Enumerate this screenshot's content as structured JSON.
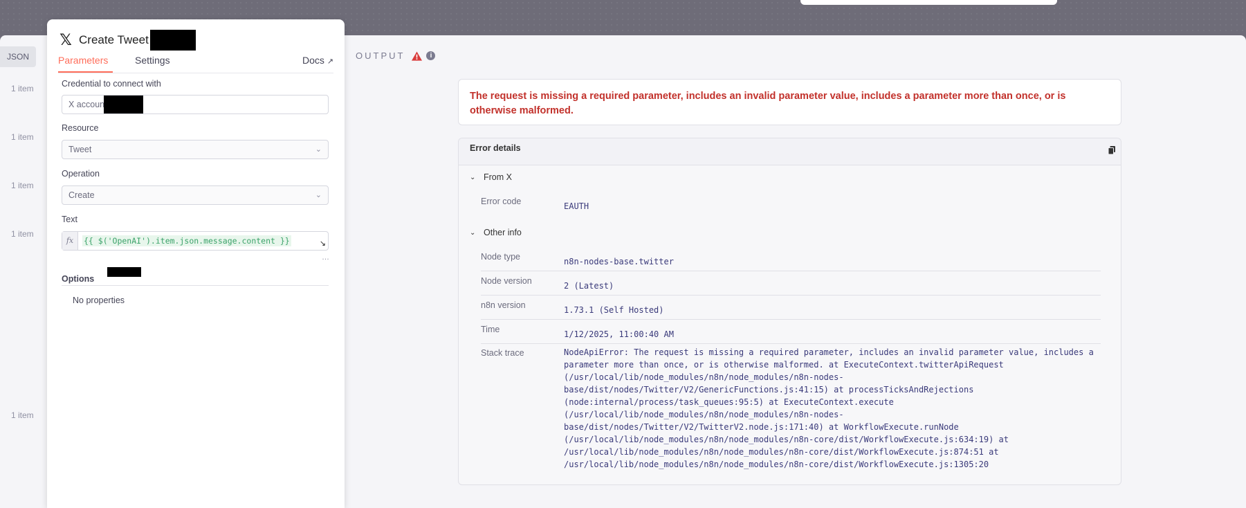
{
  "input_panel": {
    "json_tab": "JSON",
    "items": [
      "1 item",
      "1 item",
      "1 item",
      "1 item",
      "1 item"
    ]
  },
  "node": {
    "title": "Create Tweet",
    "tabs": [
      {
        "label": "Parameters",
        "active": true
      },
      {
        "label": "Settings",
        "active": false
      }
    ],
    "docs_label": "Docs",
    "credential": {
      "label": "Credential to connect with",
      "value": "X accoun"
    },
    "resource": {
      "label": "Resource",
      "value": "Tweet"
    },
    "operation": {
      "label": "Operation",
      "value": "Create"
    },
    "text": {
      "label": "Text",
      "fx": "fx",
      "expression": "{{ $('OpenAI').item.json.message.content }}"
    },
    "options": {
      "label": "Options",
      "empty": "No properties"
    }
  },
  "output": {
    "title": "OUTPUT",
    "error_message": "The request is missing a required parameter, includes an invalid parameter value, includes a parameter more than once, or is otherwise malformed.",
    "details": {
      "title": "Error details",
      "from_section": "From X",
      "error_code_label": "Error code",
      "error_code": "EAUTH",
      "other_section": "Other info",
      "rows": [
        {
          "label": "Node type",
          "value": "n8n-nodes-base.twitter"
        },
        {
          "label": "Node version",
          "value": "2 (Latest)"
        },
        {
          "label": "n8n version",
          "value": "1.73.1 (Self Hosted)"
        },
        {
          "label": "Time",
          "value": "1/12/2025, 11:00:40 AM"
        }
      ],
      "stack_label": "Stack trace",
      "stack_trace": "NodeApiError: The request is missing a required parameter, includes an invalid parameter value, includes a parameter more than once, or is otherwise malformed. at ExecuteContext.twitterApiRequest (/usr/local/lib/node_modules/n8n/node_modules/n8n-nodes-base/dist/nodes/Twitter/V2/GenericFunctions.js:41:15) at processTicksAndRejections (node:internal/process/task_queues:95:5) at ExecuteContext.execute (/usr/local/lib/node_modules/n8n/node_modules/n8n-nodes-base/dist/nodes/Twitter/V2/TwitterV2.node.js:171:40) at WorkflowExecute.runNode (/usr/local/lib/node_modules/n8n/node_modules/n8n-core/dist/WorkflowExecute.js:634:19) at /usr/local/lib/node_modules/n8n/node_modules/n8n-core/dist/WorkflowExecute.js:874:51 at /usr/local/lib/node_modules/n8n/node_modules/n8n-core/dist/WorkflowExecute.js:1305:20"
    }
  }
}
